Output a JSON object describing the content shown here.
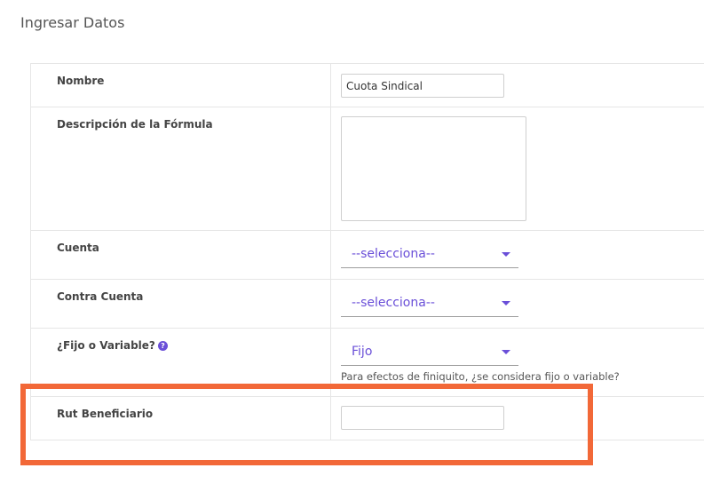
{
  "page": {
    "title": "Ingresar Datos"
  },
  "form": {
    "nombre": {
      "label": "Nombre",
      "value": "Cuota Sindical"
    },
    "descripcion": {
      "label": "Descripción de la Fórmula",
      "value": ""
    },
    "cuenta": {
      "label": "Cuenta",
      "selected": "--selecciona--"
    },
    "contra_cuenta": {
      "label": "Contra Cuenta",
      "selected": "--selecciona--"
    },
    "fijo_variable": {
      "label": "¿Fijo o Variable?",
      "help_glyph": "?",
      "selected": "Fijo",
      "helper": "Para efectos de finiquito, ¿se considera fijo o variable?"
    },
    "rut_beneficiario": {
      "label": "Rut Beneficiario",
      "value": ""
    }
  },
  "colors": {
    "accent": "#6a4fd8",
    "highlight": "#f26838",
    "border": "#e6e6e6"
  },
  "icons": {
    "select_caret": "caret-down-icon",
    "help": "question-circle-icon"
  }
}
